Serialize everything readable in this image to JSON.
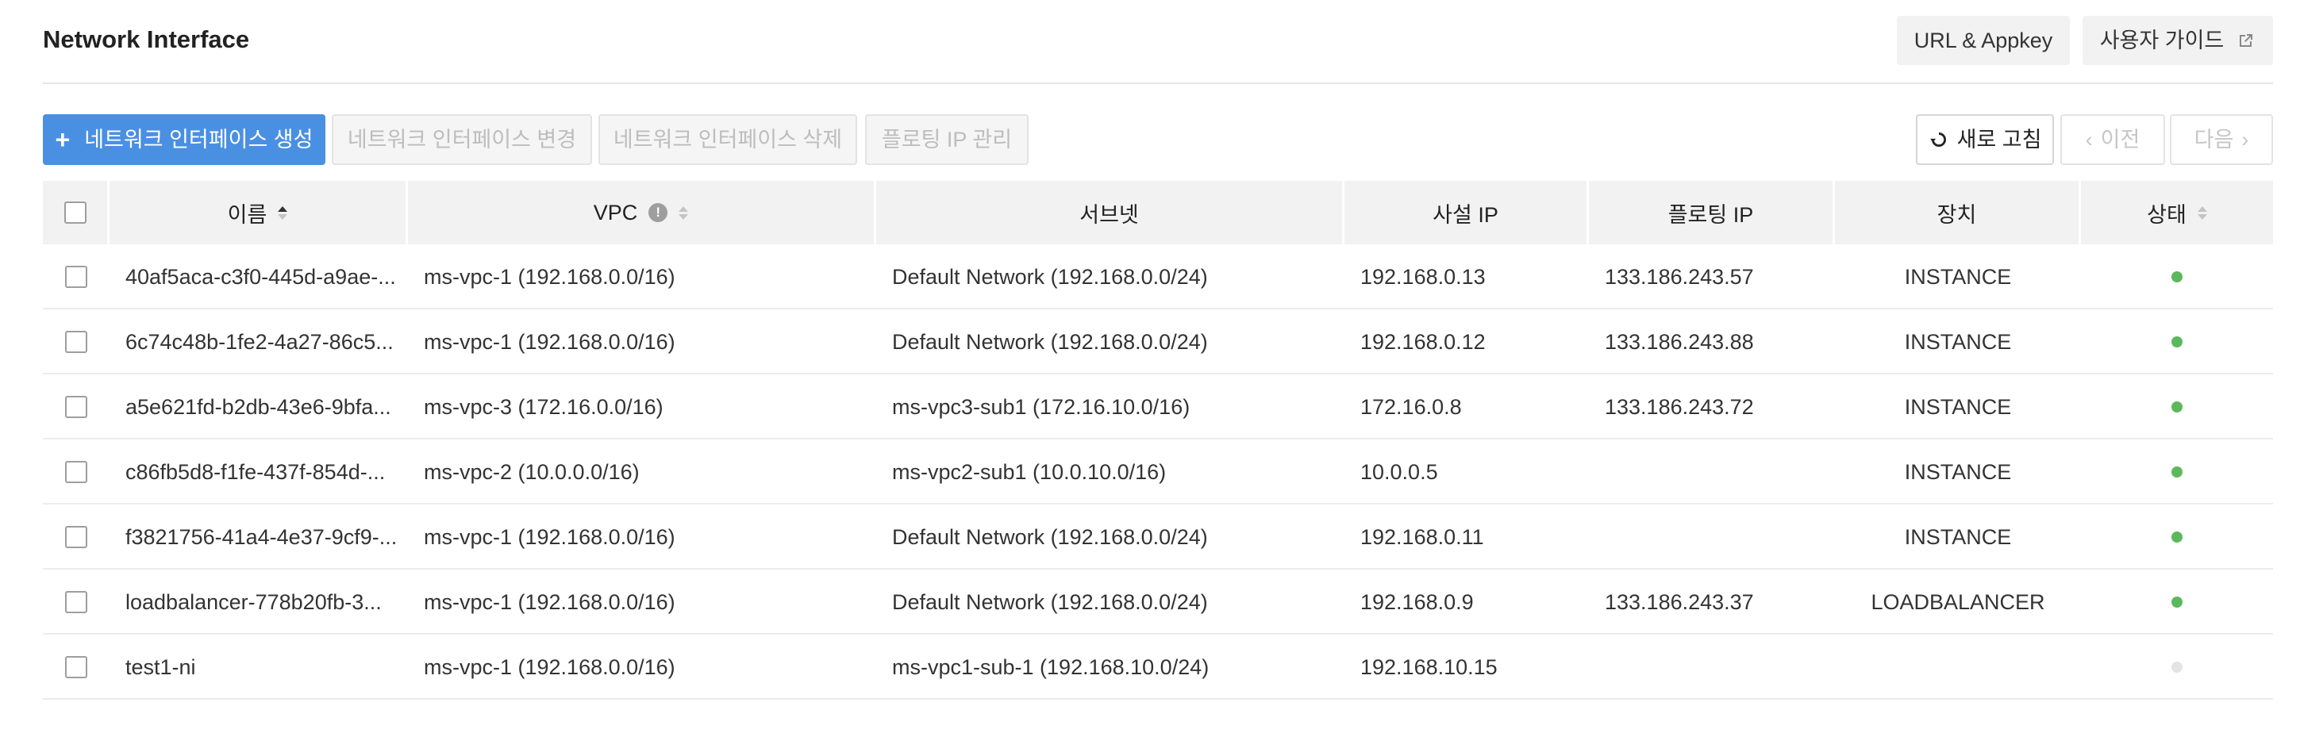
{
  "header": {
    "title": "Network Interface",
    "url_appkey_label": "URL & Appkey",
    "user_guide_label": "사용자 가이드"
  },
  "toolbar": {
    "create_label": "네트워크 인터페이스 생성",
    "create_icon": "+",
    "modify_label": "네트워크 인터페이스 변경",
    "delete_label": "네트워크 인터페이스 삭제",
    "floating_ip_label": "플로팅 IP 관리",
    "refresh_label": "새로 고침",
    "prev_label": "이전",
    "next_label": "다음",
    "prev_icon": "‹",
    "next_icon": "›"
  },
  "table": {
    "columns": {
      "name": "이름",
      "vpc": "VPC",
      "subnet": "서브넷",
      "private_ip": "사설 IP",
      "floating_ip": "플로팅 IP",
      "device": "장치",
      "status": "상태"
    },
    "rows": [
      {
        "name": "40af5aca-c3f0-445d-a9ae-...",
        "vpc": "ms-vpc-1 (192.168.0.0/16)",
        "subnet": "Default Network (192.168.0.0/24)",
        "private_ip": "192.168.0.13",
        "floating_ip": "133.186.243.57",
        "device": "INSTANCE",
        "status_color": "#5cb85c"
      },
      {
        "name": "6c74c48b-1fe2-4a27-86c5...",
        "vpc": "ms-vpc-1 (192.168.0.0/16)",
        "subnet": "Default Network (192.168.0.0/24)",
        "private_ip": "192.168.0.12",
        "floating_ip": "133.186.243.88",
        "device": "INSTANCE",
        "status_color": "#5cb85c"
      },
      {
        "name": "a5e621fd-b2db-43e6-9bfa...",
        "vpc": "ms-vpc-3 (172.16.0.0/16)",
        "subnet": "ms-vpc3-sub1 (172.16.10.0/16)",
        "private_ip": "172.16.0.8",
        "floating_ip": "133.186.243.72",
        "device": "INSTANCE",
        "status_color": "#5cb85c"
      },
      {
        "name": "c86fb5d8-f1fe-437f-854d-...",
        "vpc": "ms-vpc-2 (10.0.0.0/16)",
        "subnet": "ms-vpc2-sub1 (10.0.10.0/16)",
        "private_ip": "10.0.0.5",
        "floating_ip": "",
        "device": "INSTANCE",
        "status_color": "#5cb85c"
      },
      {
        "name": "f3821756-41a4-4e37-9cf9-...",
        "vpc": "ms-vpc-1 (192.168.0.0/16)",
        "subnet": "Default Network (192.168.0.0/24)",
        "private_ip": "192.168.0.11",
        "floating_ip": "",
        "device": "INSTANCE",
        "status_color": "#5cb85c"
      },
      {
        "name": "loadbalancer-778b20fb-3...",
        "vpc": "ms-vpc-1 (192.168.0.0/16)",
        "subnet": "Default Network (192.168.0.0/24)",
        "private_ip": "192.168.0.9",
        "floating_ip": "133.186.243.37",
        "device": "LOADBALANCER",
        "status_color": "#5cb85c"
      },
      {
        "name": "test1-ni",
        "vpc": "ms-vpc-1 (192.168.0.0/16)",
        "subnet": "ms-vpc1-sub-1 (192.168.10.0/24)",
        "private_ip": "192.168.10.15",
        "floating_ip": "",
        "device": "",
        "status_color": "#e4e4e4"
      }
    ]
  },
  "colors": {
    "primary": "#4a90e2",
    "status_active": "#5cb85c",
    "status_inactive": "#e4e4e4"
  }
}
